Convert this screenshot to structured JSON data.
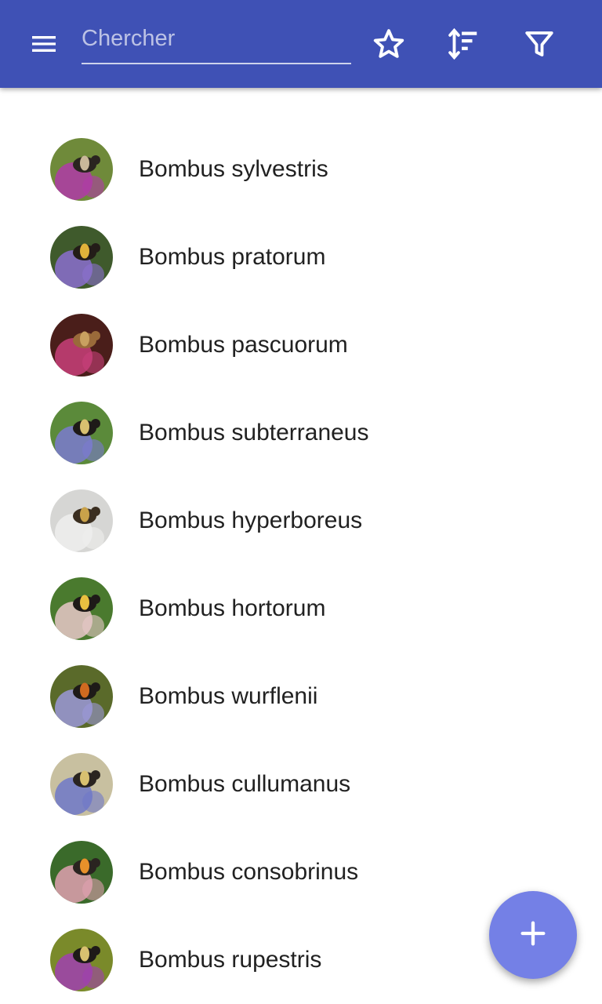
{
  "toolbar": {
    "background": "#3F51B5",
    "menu_icon": "menu-icon",
    "search": {
      "placeholder": "Chercher",
      "value": ""
    },
    "favorites_icon": "star-outline-icon",
    "sort_icon": "sort-icon",
    "filter_icon": "filter-icon"
  },
  "species": [
    {
      "name": "Bombus sylvestris",
      "thumb": {
        "bg": "#6f8a3a",
        "flower": "#b03aa8",
        "body": "#2a2420",
        "band": "#c9b89a"
      }
    },
    {
      "name": "Bombus pratorum",
      "thumb": {
        "bg": "#3f5a2c",
        "flower": "#8b6fcf",
        "body": "#231c18",
        "band": "#e0b23a"
      }
    },
    {
      "name": "Bombus pascuorum",
      "thumb": {
        "bg": "#4a1e1a",
        "flower": "#c8407a",
        "body": "#9a6a3a",
        "band": "#c9a060"
      }
    },
    {
      "name": "Bombus subterraneus",
      "thumb": {
        "bg": "#5b8a3a",
        "flower": "#7b7ad0",
        "body": "#1e1a18",
        "band": "#d8c070"
      }
    },
    {
      "name": "Bombus hyperboreus",
      "thumb": {
        "bg": "#d6d6d4",
        "flower": "#efefed",
        "body": "#3a2e20",
        "band": "#c9a24a"
      }
    },
    {
      "name": "Bombus hortorum",
      "thumb": {
        "bg": "#4a7a2e",
        "flower": "#e8c8c8",
        "body": "#1e1a18",
        "band": "#e8c040"
      }
    },
    {
      "name": "Bombus wurflenii",
      "thumb": {
        "bg": "#5a6a2a",
        "flower": "#9b98d8",
        "body": "#1e1a18",
        "band": "#d06a20"
      }
    },
    {
      "name": "Bombus cullumanus",
      "thumb": {
        "bg": "#c8c0a0",
        "flower": "#6f78c8",
        "body": "#2a2420",
        "band": "#d8c070"
      }
    },
    {
      "name": "Bombus consobrinus",
      "thumb": {
        "bg": "#3a6a2a",
        "flower": "#e0a0b0",
        "body": "#2a2420",
        "band": "#e8902a"
      }
    },
    {
      "name": "Bombus rupestris",
      "thumb": {
        "bg": "#7a8a2a",
        "flower": "#a040b0",
        "body": "#1e1a18",
        "band": "#d8c070"
      }
    }
  ],
  "fab": {
    "icon": "plus-icon",
    "color": "#7480E6"
  }
}
